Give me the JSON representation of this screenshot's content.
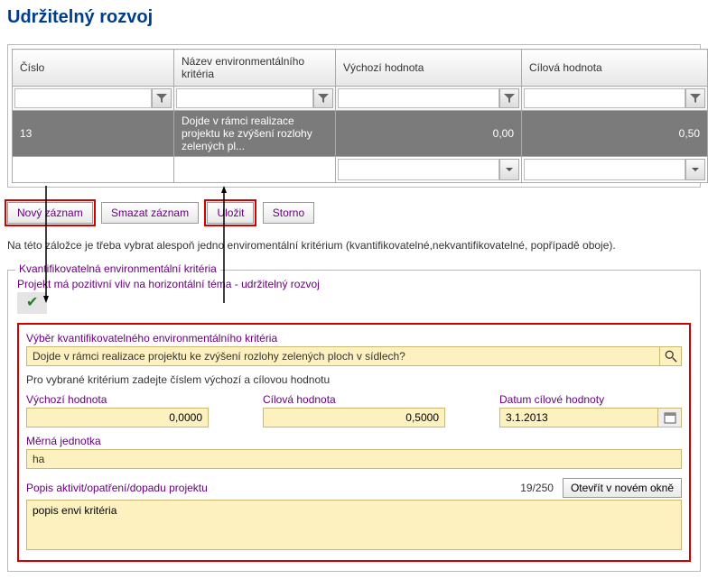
{
  "page_title": "Udržitelný rozvoj",
  "table": {
    "headers": {
      "cislo": "Číslo",
      "nazev": "Název environmentálního kritéria",
      "vychozi": "Výchozí hodnota",
      "cilova": "Cílová hodnota"
    },
    "row": {
      "cislo": "13",
      "nazev": "Dojde v rámci realizace projektu ke zvýšení rozlohy zelených pl...",
      "vychozi": "0,00",
      "cilova": "0,50"
    }
  },
  "buttons": {
    "novy": "Nový záznam",
    "smazat": "Smazat záznam",
    "ulozit": "Uložit",
    "storno": "Storno"
  },
  "info_text": "Na této záložce je třeba vybrat alespoň jedno enviromentální kritérium (kvantifikovatelné,nekvantifikovatelné, popřípadě oboje).",
  "fieldset": {
    "legend": "Kvantifikovatelná environmentální kritéria",
    "subtitle": "Projekt má pozitivní vliv na horizontální téma - udržitelný rozvoj",
    "checkmark": "✔",
    "select_label": "Výběr kvantifikovatelného environmentálního kritéria",
    "select_value": "Dojde v rámci realizace projektu ke zvýšení rozlohy zelených ploch v sídlech?",
    "values_instruction": "Pro vybrané kritérium zadejte číslem výchozí a cílovou hodnotu",
    "vychozi_label": "Výchozí hodnota",
    "vychozi_value": "0,0000",
    "cilova_label": "Cílová hodnota",
    "cilova_value": "0,5000",
    "datum_label": "Datum cílové hodnoty",
    "datum_value": "3.1.2013",
    "unit_label": "Měrná jednotka",
    "unit_value": "ha",
    "desc_label": "Popis aktivit/opatření/dopadu projektu",
    "desc_counter": "19/250",
    "open_new": "Otevřít v novém okně",
    "desc_value": "popis envi kritéria"
  }
}
